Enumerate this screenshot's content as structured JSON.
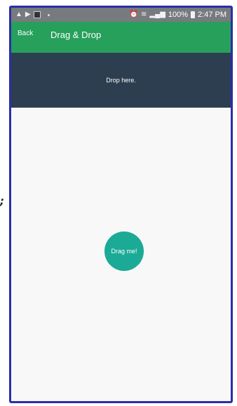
{
  "status_bar": {
    "battery_percent": "100%",
    "time": "2:47 PM"
  },
  "header": {
    "back_label": "Back",
    "title": "Drag & Drop"
  },
  "drop_zone": {
    "label": "Drop here."
  },
  "draggable": {
    "label": "Drag me!"
  },
  "colors": {
    "status_bar": "#777a7e",
    "header": "#27a05b",
    "drop_zone": "#2d3e50",
    "draggable": "#1aaa96",
    "background": "#f8f8f8",
    "frame_border": "#2b2fa8"
  }
}
